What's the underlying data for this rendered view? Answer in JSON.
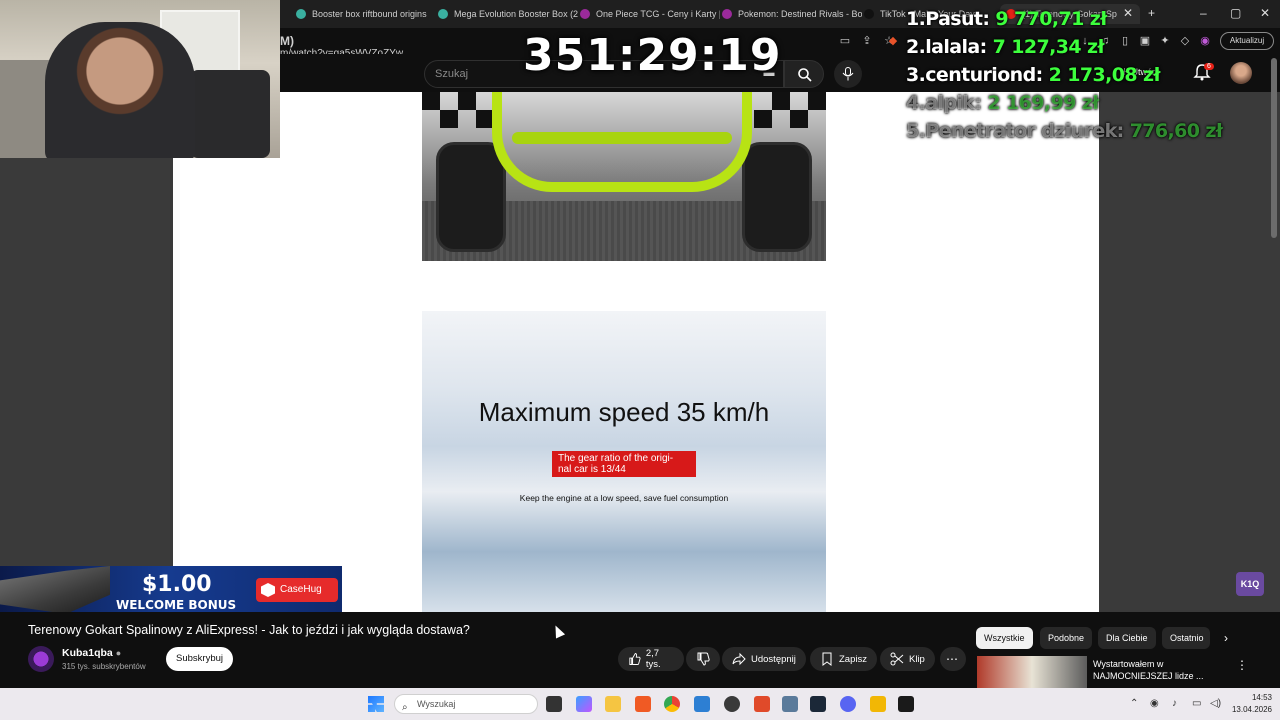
{
  "browser": {
    "tabs": [
      {
        "label": "Booster box riftbound origins",
        "favicon_color": "#3ab0a0"
      },
      {
        "label": "Mega Evolution Booster Box (2",
        "favicon_color": "#3ab0a0"
      },
      {
        "label": "One Piece TCG - Ceny i Karty |",
        "favicon_color": "#9b2a9b"
      },
      {
        "label": "Pokemon: Destined Rivals - Bo",
        "favicon_color": "#9b2a9b"
      },
      {
        "label": "TikTok - Make Your Day",
        "favicon_color": "#111111"
      },
      {
        "label": "(1) Terenowy Gokart Sp",
        "favicon_color": "#e62117"
      }
    ],
    "url": "m/watch?v=ga5sWVZoZYw",
    "url_prefix": "M)",
    "update_label": "Aktualizuj"
  },
  "youtube_header": {
    "search_placeholder": "Szukaj",
    "create_label": "Utwórz",
    "notification_count": "6"
  },
  "overlay": {
    "timer": "351:29:19",
    "leaderboard": [
      {
        "rank": "1.",
        "name": "Pasut:",
        "amount": "9 770,71 zł",
        "faded": false
      },
      {
        "rank": "2.",
        "name": "lalala:",
        "amount": "7 127,34 zł",
        "faded": false
      },
      {
        "rank": "3.",
        "name": "centuriond:",
        "amount": "2 173,08 zł",
        "faded": false
      },
      {
        "rank": "4.",
        "name": "alpik:",
        "amount": "2 169,99 zł",
        "faded": true
      },
      {
        "rank": "5.",
        "name": "Penetrator dziurek:",
        "amount": "776,60 zł",
        "faded": true
      }
    ]
  },
  "product_page": {
    "speed_title": "Maximum speed 35 km/h",
    "gear_note": "The gear ratio of the origi-\nnal car is 13/44",
    "engine_note": "Keep the engine at a low speed, save fuel consumption"
  },
  "banner": {
    "amount": "$1.00",
    "bonus_label": "WELCOME BONUS",
    "brand": "CaseHug"
  },
  "corner_logo": "K1Q",
  "video": {
    "title": "Terenowy Gokart Spalinowy z AliExpress! - Jak to jeździ i jak wygląda dostawa?",
    "channel_name": "Kuba1qba",
    "channel_subs": "315 tys. subskrybentów",
    "subscribe_label": "Subskrybuj",
    "likes": "2,7 tys.",
    "share_label": "Udostępnij",
    "save_label": "Zapisz",
    "clip_label": "Klip"
  },
  "sidebar": {
    "chips": [
      "Wszystkie",
      "Podobne",
      "Dla Ciebie",
      "Ostatnio"
    ],
    "active_chip": "Wszystkie",
    "recommended_title": "Wystartowałem w NAJMOCNIEJSZEJ lidze ..."
  },
  "taskbar": {
    "search_placeholder": "Wyszukaj",
    "time": "14:53",
    "date": "13.04.2026"
  },
  "colors": {
    "leaderboard_amount": "#3dff3d",
    "gear_box": "#d71919",
    "kart_frame": "#b8e314",
    "banner_brand": "#e62b2b"
  }
}
